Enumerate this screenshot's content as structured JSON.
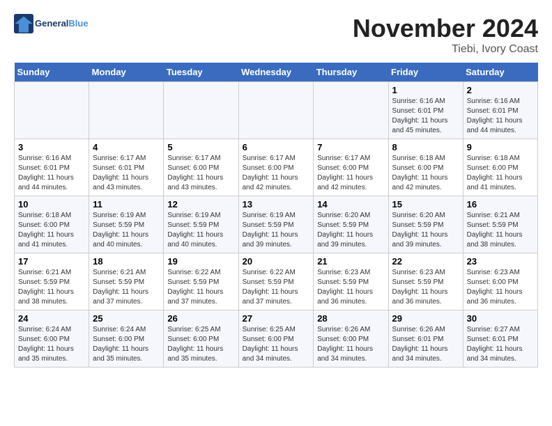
{
  "logo": {
    "text_general": "General",
    "text_blue": "Blue"
  },
  "header": {
    "month": "November 2024",
    "location": "Tiebi, Ivory Coast"
  },
  "weekdays": [
    "Sunday",
    "Monday",
    "Tuesday",
    "Wednesday",
    "Thursday",
    "Friday",
    "Saturday"
  ],
  "weeks": [
    [
      {
        "day": "",
        "info": ""
      },
      {
        "day": "",
        "info": ""
      },
      {
        "day": "",
        "info": ""
      },
      {
        "day": "",
        "info": ""
      },
      {
        "day": "",
        "info": ""
      },
      {
        "day": "1",
        "info": "Sunrise: 6:16 AM\nSunset: 6:01 PM\nDaylight: 11 hours and 45 minutes."
      },
      {
        "day": "2",
        "info": "Sunrise: 6:16 AM\nSunset: 6:01 PM\nDaylight: 11 hours and 44 minutes."
      }
    ],
    [
      {
        "day": "3",
        "info": "Sunrise: 6:16 AM\nSunset: 6:01 PM\nDaylight: 11 hours and 44 minutes."
      },
      {
        "day": "4",
        "info": "Sunrise: 6:17 AM\nSunset: 6:01 PM\nDaylight: 11 hours and 43 minutes."
      },
      {
        "day": "5",
        "info": "Sunrise: 6:17 AM\nSunset: 6:00 PM\nDaylight: 11 hours and 43 minutes."
      },
      {
        "day": "6",
        "info": "Sunrise: 6:17 AM\nSunset: 6:00 PM\nDaylight: 11 hours and 42 minutes."
      },
      {
        "day": "7",
        "info": "Sunrise: 6:17 AM\nSunset: 6:00 PM\nDaylight: 11 hours and 42 minutes."
      },
      {
        "day": "8",
        "info": "Sunrise: 6:18 AM\nSunset: 6:00 PM\nDaylight: 11 hours and 42 minutes."
      },
      {
        "day": "9",
        "info": "Sunrise: 6:18 AM\nSunset: 6:00 PM\nDaylight: 11 hours and 41 minutes."
      }
    ],
    [
      {
        "day": "10",
        "info": "Sunrise: 6:18 AM\nSunset: 6:00 PM\nDaylight: 11 hours and 41 minutes."
      },
      {
        "day": "11",
        "info": "Sunrise: 6:19 AM\nSunset: 5:59 PM\nDaylight: 11 hours and 40 minutes."
      },
      {
        "day": "12",
        "info": "Sunrise: 6:19 AM\nSunset: 5:59 PM\nDaylight: 11 hours and 40 minutes."
      },
      {
        "day": "13",
        "info": "Sunrise: 6:19 AM\nSunset: 5:59 PM\nDaylight: 11 hours and 39 minutes."
      },
      {
        "day": "14",
        "info": "Sunrise: 6:20 AM\nSunset: 5:59 PM\nDaylight: 11 hours and 39 minutes."
      },
      {
        "day": "15",
        "info": "Sunrise: 6:20 AM\nSunset: 5:59 PM\nDaylight: 11 hours and 39 minutes."
      },
      {
        "day": "16",
        "info": "Sunrise: 6:21 AM\nSunset: 5:59 PM\nDaylight: 11 hours and 38 minutes."
      }
    ],
    [
      {
        "day": "17",
        "info": "Sunrise: 6:21 AM\nSunset: 5:59 PM\nDaylight: 11 hours and 38 minutes."
      },
      {
        "day": "18",
        "info": "Sunrise: 6:21 AM\nSunset: 5:59 PM\nDaylight: 11 hours and 37 minutes."
      },
      {
        "day": "19",
        "info": "Sunrise: 6:22 AM\nSunset: 5:59 PM\nDaylight: 11 hours and 37 minutes."
      },
      {
        "day": "20",
        "info": "Sunrise: 6:22 AM\nSunset: 5:59 PM\nDaylight: 11 hours and 37 minutes."
      },
      {
        "day": "21",
        "info": "Sunrise: 6:23 AM\nSunset: 5:59 PM\nDaylight: 11 hours and 36 minutes."
      },
      {
        "day": "22",
        "info": "Sunrise: 6:23 AM\nSunset: 5:59 PM\nDaylight: 11 hours and 36 minutes."
      },
      {
        "day": "23",
        "info": "Sunrise: 6:23 AM\nSunset: 6:00 PM\nDaylight: 11 hours and 36 minutes."
      }
    ],
    [
      {
        "day": "24",
        "info": "Sunrise: 6:24 AM\nSunset: 6:00 PM\nDaylight: 11 hours and 35 minutes."
      },
      {
        "day": "25",
        "info": "Sunrise: 6:24 AM\nSunset: 6:00 PM\nDaylight: 11 hours and 35 minutes."
      },
      {
        "day": "26",
        "info": "Sunrise: 6:25 AM\nSunset: 6:00 PM\nDaylight: 11 hours and 35 minutes."
      },
      {
        "day": "27",
        "info": "Sunrise: 6:25 AM\nSunset: 6:00 PM\nDaylight: 11 hours and 34 minutes."
      },
      {
        "day": "28",
        "info": "Sunrise: 6:26 AM\nSunset: 6:00 PM\nDaylight: 11 hours and 34 minutes."
      },
      {
        "day": "29",
        "info": "Sunrise: 6:26 AM\nSunset: 6:01 PM\nDaylight: 11 hours and 34 minutes."
      },
      {
        "day": "30",
        "info": "Sunrise: 6:27 AM\nSunset: 6:01 PM\nDaylight: 11 hours and 34 minutes."
      }
    ]
  ]
}
